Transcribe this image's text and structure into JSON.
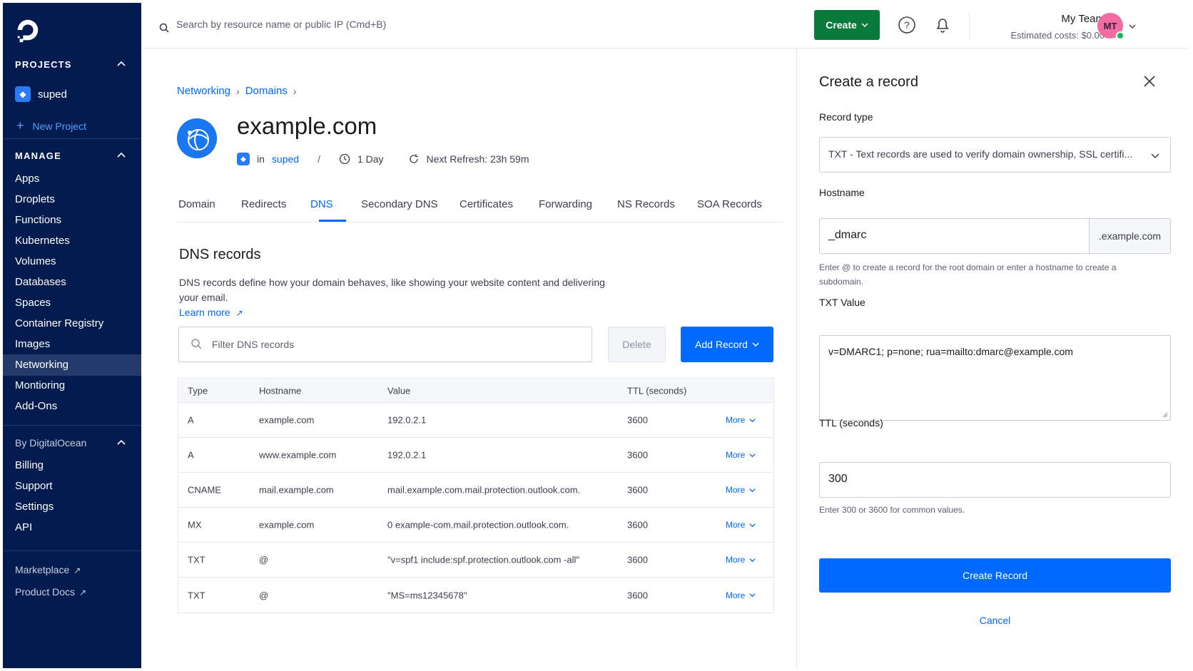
{
  "sidebar": {
    "projects_heading": "PROJECTS",
    "project_name": "suped",
    "new_project": "New Project",
    "manage_heading": "MANAGE",
    "manage_items": [
      "Apps",
      "Droplets",
      "Functions",
      "Kubernetes",
      "Volumes",
      "Databases",
      "Spaces",
      "Container Registry",
      "Images",
      "Networking",
      "Montioring",
      "Add-Ons"
    ],
    "active_item": "Networking",
    "by_heading": "By DigitalOcean",
    "by_items": [
      "Billing",
      "Support",
      "Settings",
      "API"
    ],
    "footer_items": [
      "Marketplace",
      "Product Docs"
    ]
  },
  "topbar": {
    "search_placeholder": "Search by resource name or public IP (Cmd+B)",
    "create_label": "Create",
    "team_name": "My Team",
    "estimated_costs": "Estimated costs: $0.00",
    "avatar_initials": "MT"
  },
  "main": {
    "breadcrumbs": [
      "Networking",
      "Domains"
    ],
    "domain": "example.com",
    "meta_in": "in",
    "meta_project": "suped",
    "meta_sep": "/",
    "meta_ttl": "1 Day",
    "meta_refresh": "Next Refresh: 23h 59m",
    "tabs": [
      "Domain",
      "Redirects",
      "DNS",
      "Secondary DNS",
      "Certificates",
      "Forwarding",
      "NS Records",
      "SOA Records"
    ],
    "active_tab": "DNS",
    "section_title": "DNS records",
    "section_desc": "DNS records define how your domain behaves, like showing your website content and delivering your email.",
    "learn_more": "Learn more",
    "filter_placeholder": "Filter DNS records",
    "delete_label": "Delete",
    "add_record_label": "Add Record",
    "table": {
      "headers": [
        "Type",
        "Hostname",
        "Value",
        "TTL (seconds)"
      ],
      "more_label": "More",
      "rows": [
        {
          "type": "A",
          "hostname": "example.com",
          "value": "192.0.2.1",
          "ttl": "3600"
        },
        {
          "type": "A",
          "hostname": "www.example.com",
          "value": "192.0.2.1",
          "ttl": "3600"
        },
        {
          "type": "CNAME",
          "hostname": "mail.example.com",
          "value": "mail.example.com.mail.protection.outlook.com.",
          "ttl": "3600"
        },
        {
          "type": "MX",
          "hostname": "example.com",
          "value": "0 example-com.mail.protection.outlook.com.",
          "ttl": "3600"
        },
        {
          "type": "TXT",
          "hostname": "@",
          "value": "\"v=spf1 include:spf.protection.outlook.com -all\"",
          "ttl": "3600"
        },
        {
          "type": "TXT",
          "hostname": "@",
          "value": "\"MS=ms12345678\"",
          "ttl": "3600"
        }
      ]
    }
  },
  "panel": {
    "title": "Create a record",
    "record_type_label": "Record type",
    "record_type_value": "TXT - Text records are used to verify domain ownership, SSL certifi...",
    "hostname_label": "Hostname",
    "hostname_value": "_dmarc",
    "hostname_suffix": ".example.com",
    "hostname_help": "Enter @ to create a record for the root domain or enter a hostname to create a subdomain.",
    "txt_label": "TXT Value",
    "txt_value": "v=DMARC1; p=none; rua=mailto:dmarc@example.com",
    "ttl_label": "TTL (seconds)",
    "ttl_value": "300",
    "ttl_help": "Enter 300 or 3600 for common values.",
    "create_label": "Create Record",
    "cancel_label": "Cancel"
  },
  "colors": {
    "sidebar_bg": "#031b4e",
    "primary": "#0069ff",
    "create_green": "#0a7a3c",
    "avatar_pink": "#f06da3",
    "online_green": "#18b25a"
  }
}
